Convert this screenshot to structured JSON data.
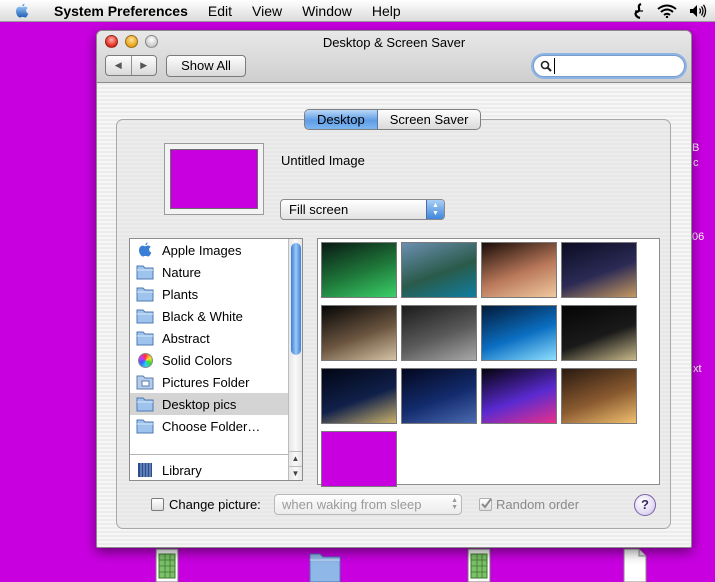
{
  "menubar": {
    "app_name": "System Preferences",
    "items": [
      "Edit",
      "View",
      "Window",
      "Help"
    ]
  },
  "desktop": {
    "fragments": [
      "B",
      "c",
      "06",
      "xt"
    ]
  },
  "window": {
    "title": "Desktop & Screen Saver",
    "toolbar": {
      "back_label": "◀",
      "forward_label": "▶",
      "show_all_label": "Show All",
      "search_value": "",
      "search_placeholder": ""
    },
    "tabs": [
      {
        "label": "Desktop",
        "active": true
      },
      {
        "label": "Screen Saver",
        "active": false
      }
    ],
    "preview": {
      "image_name": "Untitled Image",
      "color": "#c800e0"
    },
    "fill_mode": {
      "selected": "Fill screen"
    },
    "source_list": {
      "items": [
        {
          "label": "Apple Images",
          "icon": "apple-icon"
        },
        {
          "label": "Nature",
          "icon": "folder-icon"
        },
        {
          "label": "Plants",
          "icon": "folder-icon"
        },
        {
          "label": "Black & White",
          "icon": "folder-icon"
        },
        {
          "label": "Abstract",
          "icon": "folder-icon"
        },
        {
          "label": "Solid Colors",
          "icon": "color-wheel-icon"
        },
        {
          "label": "Pictures Folder",
          "icon": "pictures-folder-icon"
        },
        {
          "label": "Desktop pics",
          "icon": "folder-icon",
          "selected": true
        },
        {
          "label": "Choose Folder…",
          "icon": "folder-icon"
        },
        {
          "label": "Library",
          "icon": "library-icon"
        }
      ]
    },
    "thumbnails": [
      {
        "name": "aurora-lake",
        "colors": [
          "#0a1a14",
          "#1f7a3a",
          "#3bd06a"
        ]
      },
      {
        "name": "mountain-lake-boat",
        "colors": [
          "#6b8fb0",
          "#2a5a4a",
          "#0f7ea0"
        ]
      },
      {
        "name": "butterfly-nebula",
        "colors": [
          "#1a0d08",
          "#b9785a",
          "#f0c9a0"
        ]
      },
      {
        "name": "city-night",
        "colors": [
          "#0b0c22",
          "#2b2a55",
          "#c69a60"
        ]
      },
      {
        "name": "jupiter-moon",
        "colors": [
          "#050505",
          "#6b5540",
          "#d6c3a5"
        ]
      },
      {
        "name": "cloudy-sky",
        "colors": [
          "#1b1b1b",
          "#5a5a5a",
          "#a8a8a8"
        ]
      },
      {
        "name": "blue-arcs",
        "colors": [
          "#031a3a",
          "#0b6fc2",
          "#8fe0ff"
        ]
      },
      {
        "name": "star-cluster",
        "colors": [
          "#050505",
          "#1a1a1a",
          "#c8b98a"
        ]
      },
      {
        "name": "eclipse-sequence",
        "colors": [
          "#020614",
          "#10204a",
          "#c9b06a"
        ]
      },
      {
        "name": "silhouettes-night",
        "colors": [
          "#03071e",
          "#132c6e",
          "#4b6ab0"
        ]
      },
      {
        "name": "ringed-planet",
        "colors": [
          "#05030d",
          "#5a2ad0",
          "#e8308a"
        ]
      },
      {
        "name": "moonrise-city",
        "colors": [
          "#2a1a10",
          "#8a5a30",
          "#f0c070"
        ]
      },
      {
        "name": "solid-magenta",
        "colors": [
          "#c800e0",
          "#c800e0",
          "#c800e0"
        ]
      }
    ],
    "change_picture": {
      "label": "Change picture:",
      "checked": false,
      "interval": "when waking from sleep"
    },
    "random_order": {
      "label": "Random order",
      "checked": true
    },
    "help_label": "?"
  }
}
